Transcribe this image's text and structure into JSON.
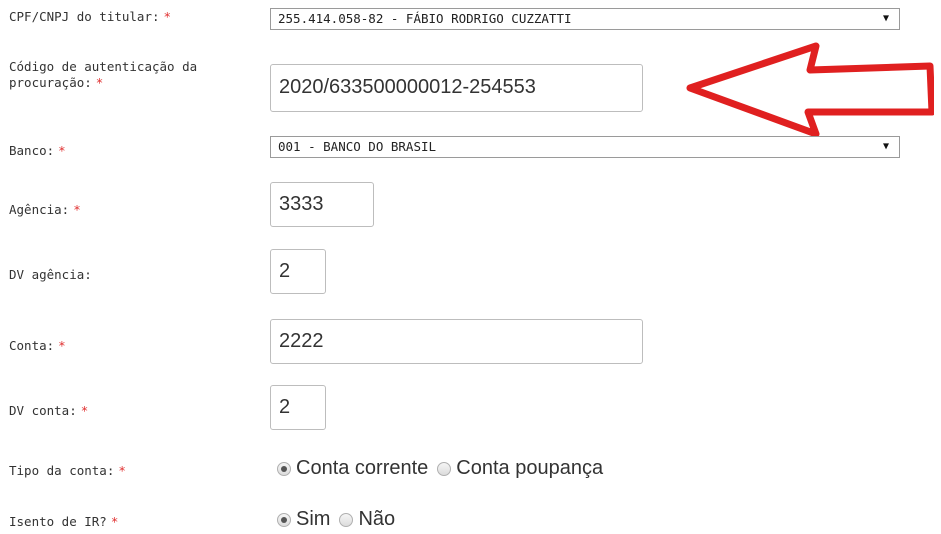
{
  "form": {
    "required_mark": "*",
    "titular": {
      "label": "CPF/CNPJ do titular:",
      "value": "255.414.058-82 - FÁBIO RODRIGO CUZZATTI",
      "arrow": "▼"
    },
    "codigo": {
      "label_line1": "Código de autenticação da",
      "label_line2": "procuração:",
      "value": "2020/633500000012-254553"
    },
    "banco": {
      "label": "Banco:",
      "value": "001 - BANCO DO BRASIL",
      "arrow": "▼"
    },
    "agencia": {
      "label": "Agência:",
      "value": "3333"
    },
    "dv_agencia": {
      "label": "DV agência:",
      "value": "2"
    },
    "conta": {
      "label": "Conta:",
      "value": "2222"
    },
    "dv_conta": {
      "label": "DV conta:",
      "value": "2"
    },
    "tipo_conta": {
      "label": "Tipo da conta:",
      "options": [
        {
          "label": "Conta corrente",
          "checked": true
        },
        {
          "label": "Conta poupança",
          "checked": false
        }
      ]
    },
    "isento_ir": {
      "label": "Isento de IR?",
      "options": [
        {
          "label": "Sim",
          "checked": true
        },
        {
          "label": "Não",
          "checked": false
        }
      ]
    }
  },
  "annotation": {
    "arrow_color": "#e02020",
    "icon": "red-arrow-left-icon"
  }
}
